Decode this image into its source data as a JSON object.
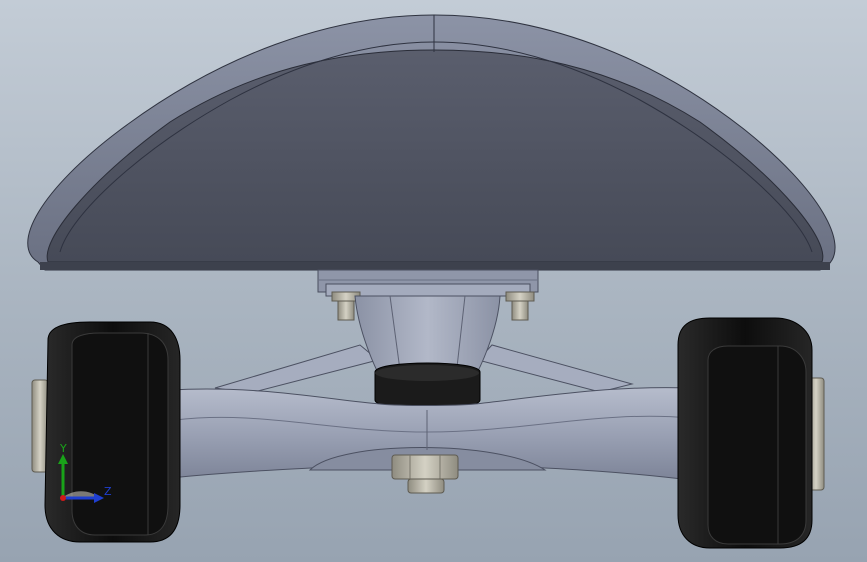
{
  "viewport": {
    "background_top": "#c3ccd6",
    "background_bottom": "#97a3b1"
  },
  "model": {
    "deck_color": "#4b4f5c",
    "truck_color": "#9ea5b7",
    "wheel_color": "#141414",
    "bushing_color": "#1b1b1b",
    "hardware_color": "#b9b5a6"
  },
  "triad": {
    "y_label": "Y",
    "z_label": "Z",
    "y_color": "#19a319",
    "z_color": "#1f3fd0",
    "x_color": "#d11a1a"
  }
}
